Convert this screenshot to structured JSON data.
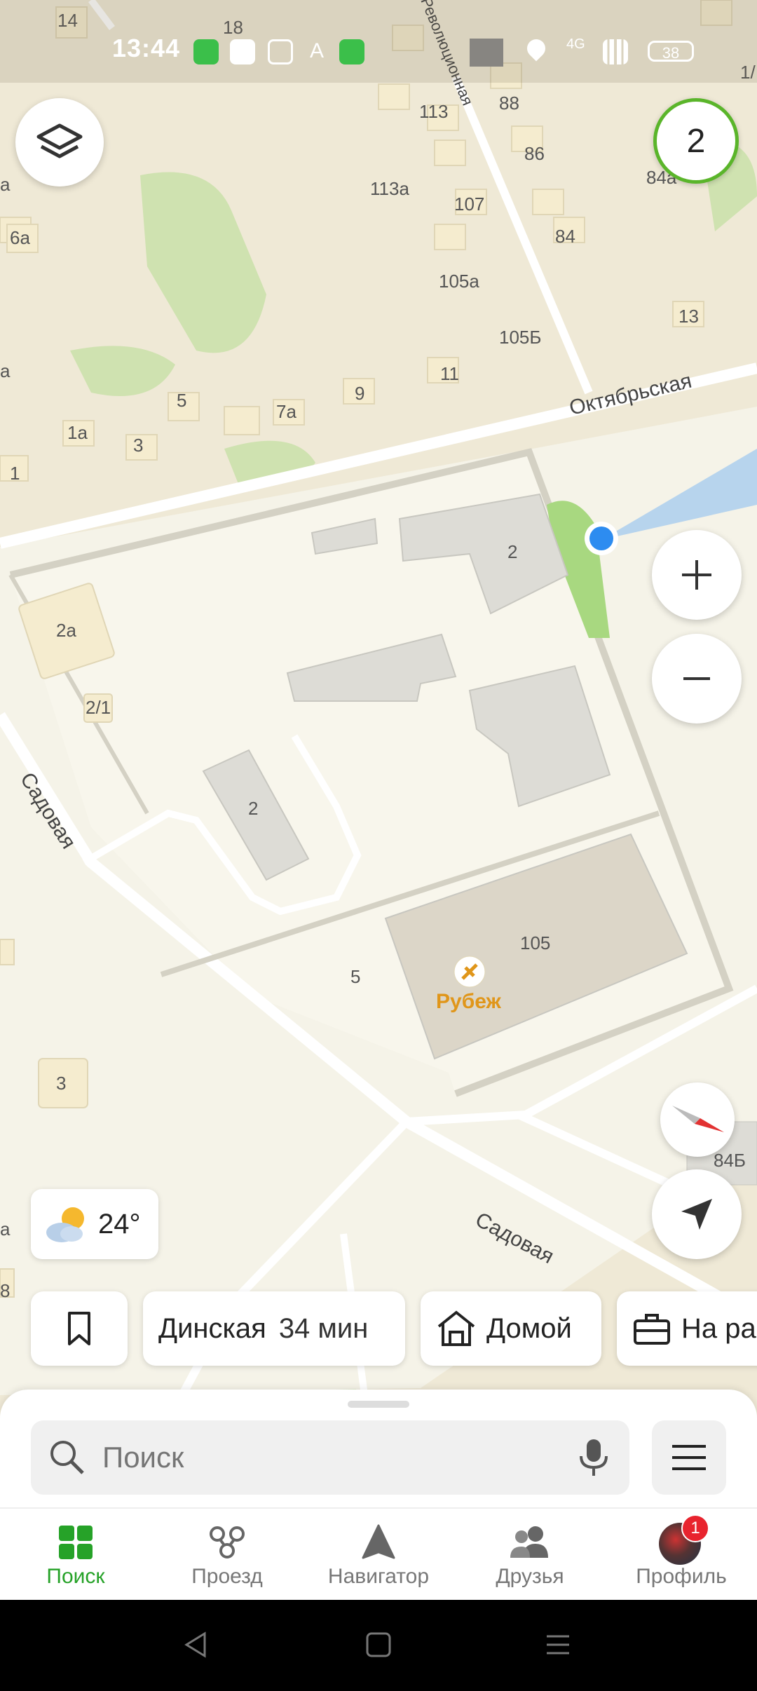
{
  "status_bar": {
    "time": "13:44",
    "network": "4G",
    "battery": "38"
  },
  "map": {
    "streets": {
      "oktyabrskaya": "Октябрьская",
      "sadovaya_1": "Садовая",
      "sadovaya_2": "Садовая",
      "revolyutsionnaya": "Революционная"
    },
    "house_labels": [
      "14",
      "18",
      "113",
      "88",
      "86",
      "84а",
      "113а",
      "107",
      "84",
      "6а",
      "105а",
      "105Б",
      "13",
      "5",
      "9",
      "11",
      "7а",
      "1а",
      "3",
      "1",
      "2",
      "2а",
      "2/1",
      "2",
      "105",
      "5",
      "3",
      "84Б",
      "1/",
      "а",
      "а",
      "а",
      "8"
    ],
    "poi": {
      "name": "Рубеж"
    }
  },
  "layer_counter": "2",
  "weather": {
    "temp": "24°"
  },
  "chips": {
    "bookmark_icon": "bookmark-icon",
    "dinskaya": {
      "name": "Динская",
      "time": "34 мин"
    },
    "home": {
      "label": "Домой"
    },
    "work": {
      "label": "На ра"
    }
  },
  "search": {
    "placeholder": "Поиск"
  },
  "bottom_nav": {
    "items": [
      {
        "label": "Поиск",
        "icon": "grid-icon"
      },
      {
        "label": "Проезд",
        "icon": "transit-icon"
      },
      {
        "label": "Навигатор",
        "icon": "navigator-icon"
      },
      {
        "label": "Друзья",
        "icon": "friends-icon"
      },
      {
        "label": "Профиль",
        "icon": "avatar-icon",
        "badge": "1"
      }
    ]
  },
  "colors": {
    "accent": "#26a228",
    "location": "#2d8cf0",
    "poi": "#e0961a"
  }
}
